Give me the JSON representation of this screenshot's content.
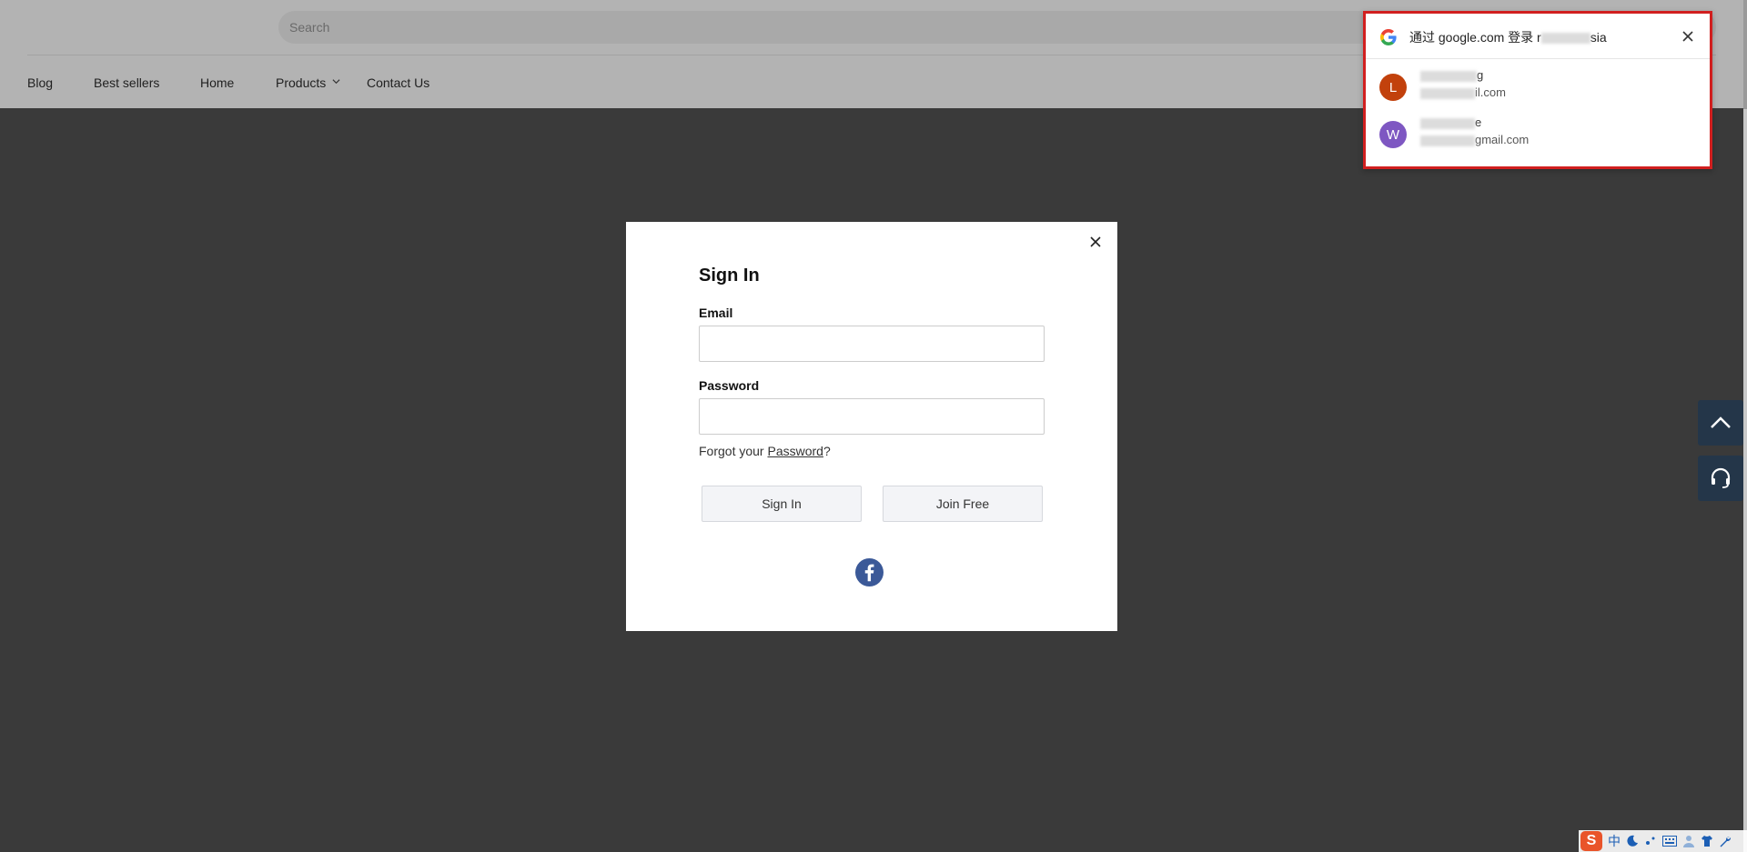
{
  "header": {
    "search_placeholder": "Search",
    "nav": [
      {
        "label": "Blog"
      },
      {
        "label": "Best sellers"
      },
      {
        "label": "Home"
      },
      {
        "label": "Products"
      },
      {
        "label": "Contact Us"
      }
    ]
  },
  "modal": {
    "title": "Sign In",
    "email_label": "Email",
    "email_value": "",
    "password_label": "Password",
    "password_value": "",
    "forgot_prefix": "Forgot your ",
    "forgot_link": "Password",
    "forgot_suffix": "?",
    "sign_in_button": "Sign In",
    "join_button": "Join Free",
    "facebook_icon": "facebook-icon"
  },
  "google_popup": {
    "title": "通过 google.com 登录 r",
    "title_suffix": "sia",
    "accounts": [
      {
        "initial": "L",
        "color": "#c2410c",
        "name_visible": "g",
        "email_visible": "il.com"
      },
      {
        "initial": "W",
        "color": "#7e57c2",
        "name_visible": "e",
        "email_visible": "gmail.com"
      }
    ]
  },
  "ime": {
    "logo": "S",
    "mode": "中"
  },
  "colors": {
    "overlay": "#3a3a3a",
    "header": "#b3b3b3",
    "float_button": "#243649",
    "highlight_border": "#d11f1f",
    "facebook": "#3b5998"
  }
}
